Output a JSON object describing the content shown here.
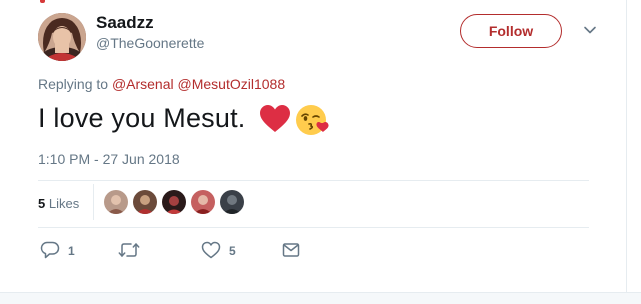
{
  "user": {
    "name": "Saadzz",
    "handle": "@TheGoonerette"
  },
  "follow_label": "Follow",
  "replying": {
    "prefix": "Replying to ",
    "mention1": "@Arsenal",
    "mention2": "@MesutOzil1088"
  },
  "tweet_text": "I love you Mesut.",
  "emojis": [
    "red-heart-emoji",
    "face-blowing-kiss-emoji"
  ],
  "timestamp": "1:10 PM - 27 Jun 2018",
  "likes": {
    "count": "5",
    "label": "Likes"
  },
  "actions": {
    "replies": "1",
    "retweets": "",
    "likes": "5"
  },
  "icons": [
    "reply-icon",
    "retweet-icon",
    "like-icon",
    "direct-message-icon",
    "chevron-down-icon"
  ],
  "colors": {
    "accent": "#b32d2d",
    "secondary_text": "#657786",
    "primary_text": "#14171a",
    "divider": "#e6ecf0"
  }
}
